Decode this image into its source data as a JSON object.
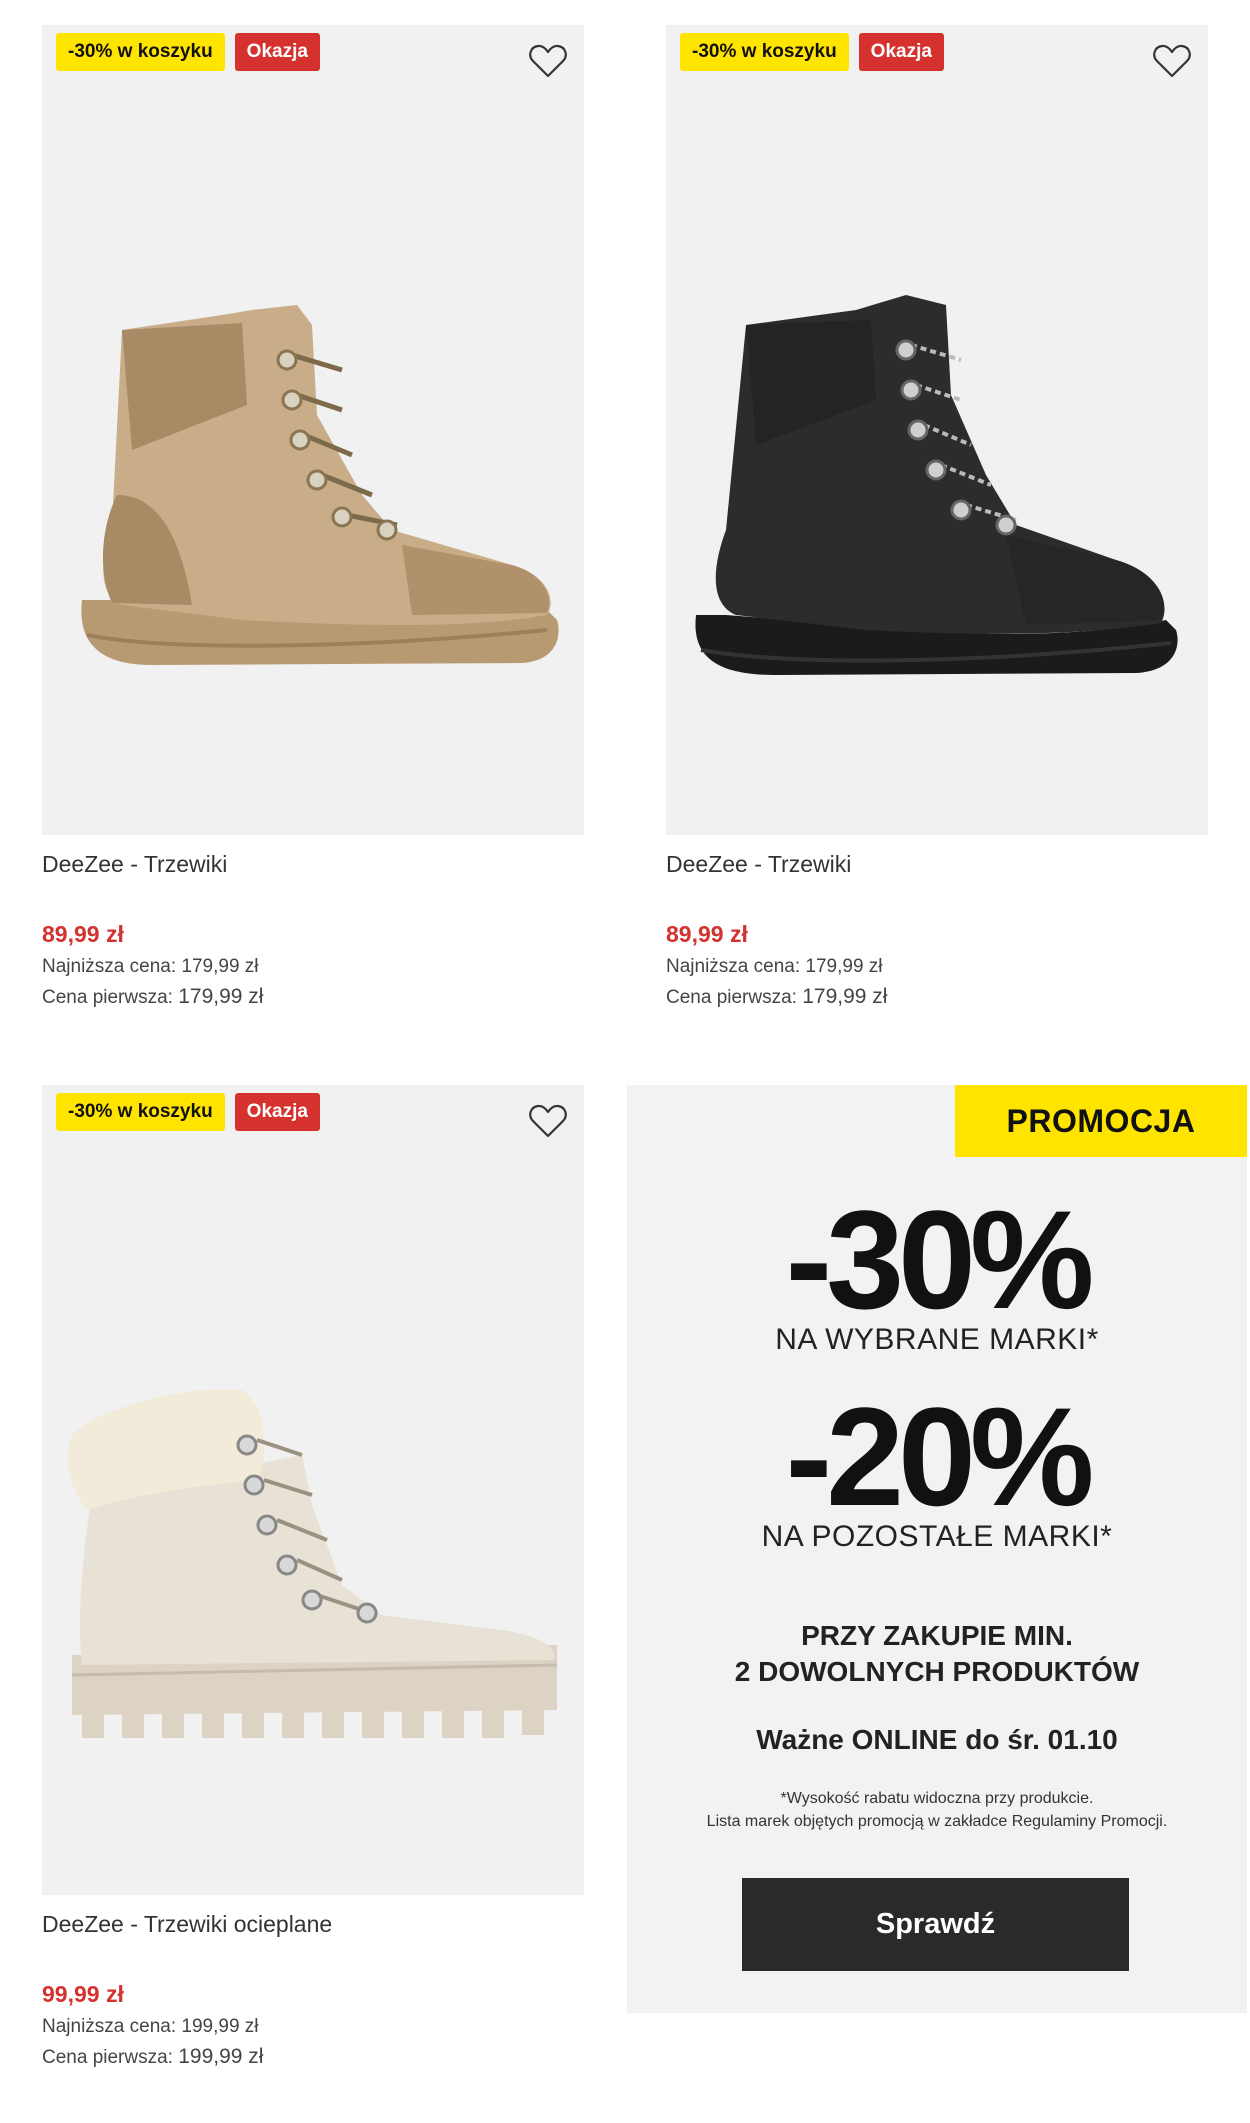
{
  "products": [
    {
      "badges": {
        "cart_discount": "-30% w koszyku",
        "deal": "Okazja"
      },
      "name": "DeeZee - Trzewiki",
      "price": "89,99 zł",
      "lowest_label": "Najniższa cena:",
      "lowest_value": "179,99 zł",
      "first_label": "Cena pierwsza:",
      "first_value": "179,99 zł",
      "image_icon": "tan-lace-up-boot-image"
    },
    {
      "badges": {
        "cart_discount": "-30% w koszyku",
        "deal": "Okazja"
      },
      "name": "DeeZee - Trzewiki",
      "price": "89,99 zł",
      "lowest_label": "Najniższa cena:",
      "lowest_value": "179,99 zł",
      "first_label": "Cena pierwsza:",
      "first_value": "179,99 zł",
      "image_icon": "black-lace-up-boot-image"
    },
    {
      "badges": {
        "cart_discount": "-30% w koszyku",
        "deal": "Okazja"
      },
      "name": "DeeZee - Trzewiki ocieplane",
      "price": "99,99 zł",
      "lowest_label": "Najniższa cena:",
      "lowest_value": "199,99 zł",
      "first_label": "Cena pierwsza:",
      "first_value": "199,99 zł",
      "image_icon": "cream-fur-lined-boot-image"
    }
  ],
  "promo": {
    "tag": "PROMOCJA",
    "big1": "-30%",
    "sub1": "NA WYBRANE MARKI*",
    "big2": "-20%",
    "sub2": "NA POZOSTAŁE MARKI*",
    "condition_line1": "PRZY ZAKUPIE MIN.",
    "condition_line2": "2 DOWOLNYCH PRODUKTÓW",
    "validity": "Ważne ONLINE do śr. 01.10",
    "note_line1": "*Wysokość rabatu widoczna przy produkcie.",
    "note_line2": "Lista marek objętych promocją w zakładce Regulaminy Promocji.",
    "cta": "Sprawdź"
  },
  "colors": {
    "badge_yellow": "#ffe400",
    "badge_red": "#d5312f",
    "price_red": "#d5312f",
    "cta_bg": "#2a2a2a",
    "promo_bg": "#f2f2f2"
  },
  "icons": {
    "wishlist": "heart-outline-icon"
  }
}
